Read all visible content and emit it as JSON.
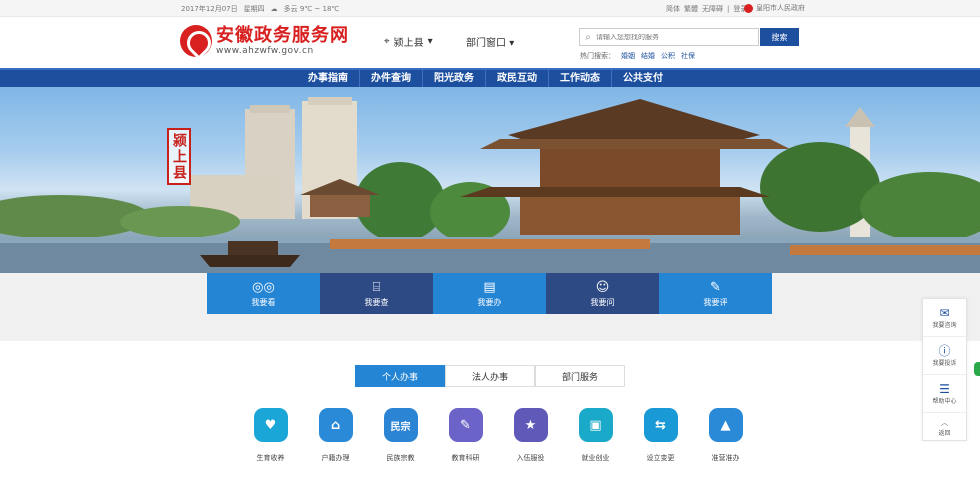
{
  "topbar": {
    "date": "2017年12月07日",
    "weekday": "星期四",
    "weather": "多云 9℃ ~ 18℃",
    "links": [
      "简体",
      "繁體",
      "无障碍",
      "|",
      "登录"
    ],
    "gov_link": "皇阳市人民政府"
  },
  "header": {
    "logo_cn": "安徽政务服务网",
    "logo_url": "www.ahzwfw.gov.cn",
    "location": "颍上县",
    "department": "部门窗口",
    "search_placeholder": "请输入您想找的服务",
    "search_button": "搜索",
    "hot_label": "热门搜索：",
    "hot_items": [
      "婚姻",
      "结婚",
      "公积",
      "社保"
    ]
  },
  "nav": {
    "items": [
      "办事指南",
      "办件查询",
      "阳光政务",
      "政民互动",
      "工作动态",
      "公共支付"
    ]
  },
  "banner": {
    "county_label": "颍上县"
  },
  "tiles": [
    {
      "label": "我要看",
      "icon": "glasses-icon",
      "glyph": "◎◎"
    },
    {
      "label": "我要查",
      "icon": "search-doc-icon",
      "glyph": "⌸"
    },
    {
      "label": "我要办",
      "icon": "document-icon",
      "glyph": "▤"
    },
    {
      "label": "我要问",
      "icon": "chat-icon",
      "glyph": "☺"
    },
    {
      "label": "我要评",
      "icon": "pen-icon",
      "glyph": "✎"
    }
  ],
  "tabs": [
    "个人办事",
    "法人办事",
    "部门服务"
  ],
  "services": [
    {
      "label": "生育收养",
      "glyph": "♥",
      "color": "#1aa6d6"
    },
    {
      "label": "户籍办理",
      "glyph": "⌂",
      "color": "#2a8ad8"
    },
    {
      "label": "民族宗教",
      "glyph": "民宗",
      "color": "#2c84d4"
    },
    {
      "label": "教育科研",
      "glyph": "✎",
      "color": "#6b63c7"
    },
    {
      "label": "入伍服役",
      "glyph": "★",
      "color": "#5f5ab8"
    },
    {
      "label": "就业创业",
      "glyph": "▣",
      "color": "#1aa9c8"
    },
    {
      "label": "设立变更",
      "glyph": "⇆",
      "color": "#199ad6"
    },
    {
      "label": "准营准办",
      "glyph": "▲",
      "color": "#2a8ad8"
    }
  ],
  "float_panel": {
    "items": [
      {
        "label": "我要咨询",
        "glyph": "✉"
      },
      {
        "label": "我要投诉",
        "glyph": "ⓘ"
      },
      {
        "label": "帮助中心",
        "glyph": "☰"
      }
    ],
    "top_label": "返回"
  },
  "colors": {
    "brand_red": "#d7201f",
    "nav_blue": "#1d4f9f",
    "tile_light": "#2585d5",
    "tile_dark": "#2d4a85"
  }
}
